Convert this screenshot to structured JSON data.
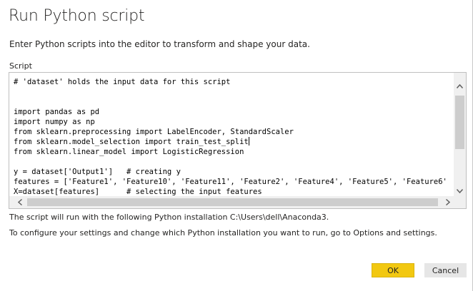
{
  "dialog": {
    "title": "Run Python script",
    "subtitle": "Enter Python scripts into the editor to transform and shape your data.",
    "script_label": "Script"
  },
  "editor": {
    "lines": [
      "# 'dataset' holds the input data for this script",
      "",
      "",
      "import pandas as pd",
      "import numpy as np",
      "from sklearn.preprocessing import LabelEncoder, StandardScaler",
      "from sklearn.model_selection import train_test_split",
      "from sklearn.linear_model import LogisticRegression",
      "",
      "y = dataset['Output1']   # creating y",
      "features = ['Feature1', 'Feature10', 'Feature11', 'Feature2', 'Feature4', 'Feature5', 'Feature6'",
      "X=dataset[features]      # selecting the input features"
    ]
  },
  "info": {
    "python_installation": "The script will run with the following Python installation C:\\Users\\dell\\Anaconda3.",
    "configure_hint": "To configure your settings and change which Python installation you want to run, go to Options and settings."
  },
  "buttons": {
    "ok": "OK",
    "cancel": "Cancel"
  },
  "icons": {
    "scroll_up": "scroll-up-arrow-icon",
    "scroll_down": "scroll-down-arrow-icon",
    "scroll_left": "scroll-left-arrow-icon",
    "scroll_right": "scroll-right-arrow-icon"
  },
  "colors": {
    "ok_button": "#f2c811",
    "cancel_button": "#e6e6e6"
  }
}
